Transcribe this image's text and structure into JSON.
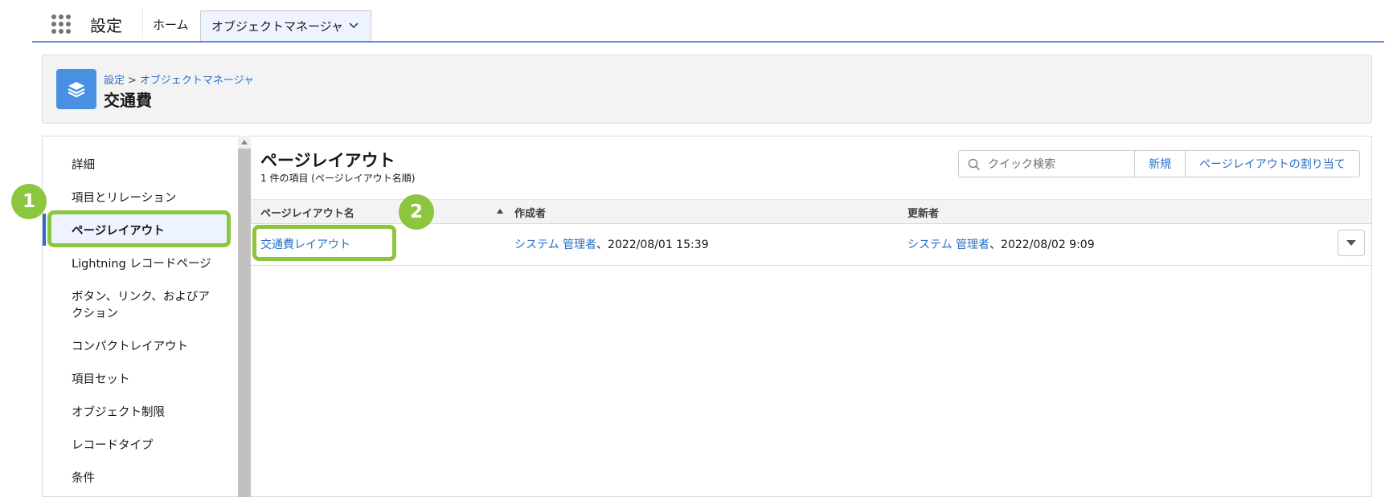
{
  "topnav": {
    "app_name": "設定",
    "home_label": "ホーム",
    "active_tab_label": "オブジェクトマネージャ"
  },
  "header": {
    "breadcrumb_root": "設定",
    "breadcrumb_separator": ">",
    "breadcrumb_current": "オブジェクトマネージャ",
    "title": "交通費"
  },
  "sidebar": {
    "items": [
      {
        "label": "詳細"
      },
      {
        "label": "項目とリレーション"
      },
      {
        "label": "ページレイアウト",
        "active": true
      },
      {
        "label": "Lightning レコードページ"
      },
      {
        "label": "ボタン、リンク、およびア"
      },
      {
        "label": "クション"
      },
      {
        "label": "コンパクトレイアウト"
      },
      {
        "label": "項目セット"
      },
      {
        "label": "オブジェクト制限"
      },
      {
        "label": "レコードタイプ"
      },
      {
        "label": "条件"
      }
    ]
  },
  "main": {
    "title": "ページレイアウト",
    "subtitle": "1 件の項目 (ページレイアウト名順)",
    "search_placeholder": "クイック検索",
    "new_button": "新規",
    "assign_button": "ページレイアウトの割り当て",
    "columns": [
      "ページレイアウト名",
      "作成者",
      "更新者"
    ],
    "rows": [
      {
        "name": "交通費レイアウト",
        "created_by": "システム 管理者",
        "created_at": "、2022/08/01 15:39",
        "modified_by": "システム 管理者",
        "modified_at": "、2022/08/02 9:09"
      }
    ]
  },
  "annotations": {
    "badge1": "1",
    "badge2": "2"
  },
  "colors": {
    "accent": "#2a6fc4",
    "highlight": "#8cc63f",
    "object_icon": "#4a90e2"
  },
  "icons": {
    "waffle": "app-launcher-icon",
    "object": "stack-icon",
    "search": "search-icon",
    "sort": "sort-ascending-icon",
    "row_menu": "chevron-down-icon"
  }
}
